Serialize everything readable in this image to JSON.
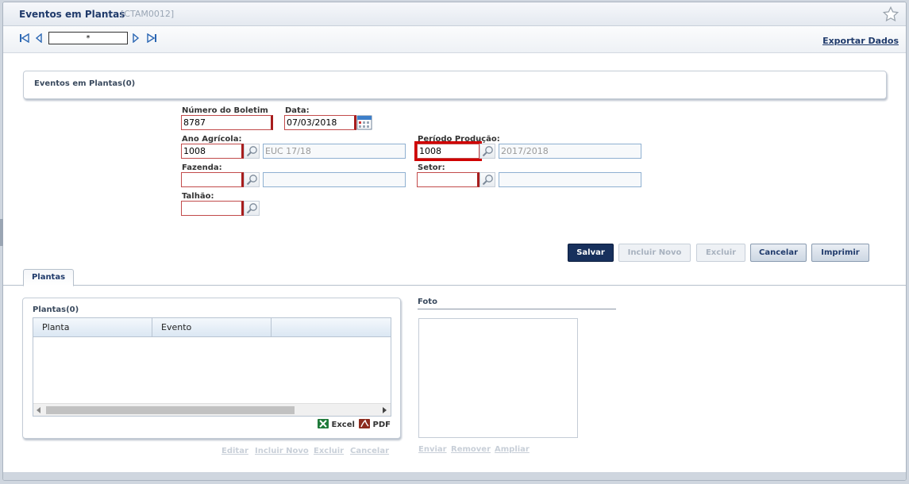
{
  "window": {
    "title": "Eventos em Plantas",
    "code": "[CTAM0012]"
  },
  "toolbar": {
    "record_input": "*",
    "export_label": "Exportar Dados"
  },
  "group": {
    "title": "Eventos em Plantas(0)"
  },
  "form": {
    "numero_boletim": {
      "label": "Número do Boletim",
      "value": "8787"
    },
    "data": {
      "label": "Data:",
      "value": "07/03/2018"
    },
    "ano_agricola": {
      "label": "Ano Agrícola:",
      "value": "1008",
      "description": "EUC 17/18"
    },
    "periodo_producao": {
      "label": "Período Produção:",
      "value": "1008",
      "description": "2017/2018"
    },
    "fazenda": {
      "label": "Fazenda:",
      "value": "",
      "description": ""
    },
    "setor": {
      "label": "Setor:",
      "value": "",
      "description": ""
    },
    "talhao": {
      "label": "Talhão:",
      "value": ""
    }
  },
  "actions": {
    "save": "Salvar",
    "new": "Incluir Novo",
    "delete": "Excluir",
    "cancel": "Cancelar",
    "print": "Imprimir"
  },
  "tabs": [
    {
      "label": "Plantas"
    }
  ],
  "plantas": {
    "title": "Plantas(0)",
    "columns": [
      "Planta",
      "Evento"
    ],
    "rows": [],
    "export_excel": "Excel",
    "export_pdf": "PDF",
    "links": {
      "edit": "Editar",
      "new": "Incluir Novo",
      "delete": "Excluir",
      "cancel": "Cancelar"
    }
  },
  "foto": {
    "title": "Foto",
    "links": {
      "send": "Enviar",
      "remove": "Remover",
      "zoom": "Ampliar"
    }
  },
  "colors": {
    "primary": "#17305c",
    "required_border": "#a71d1d",
    "highlight": "#d00000",
    "title": "#1f3a6b"
  }
}
